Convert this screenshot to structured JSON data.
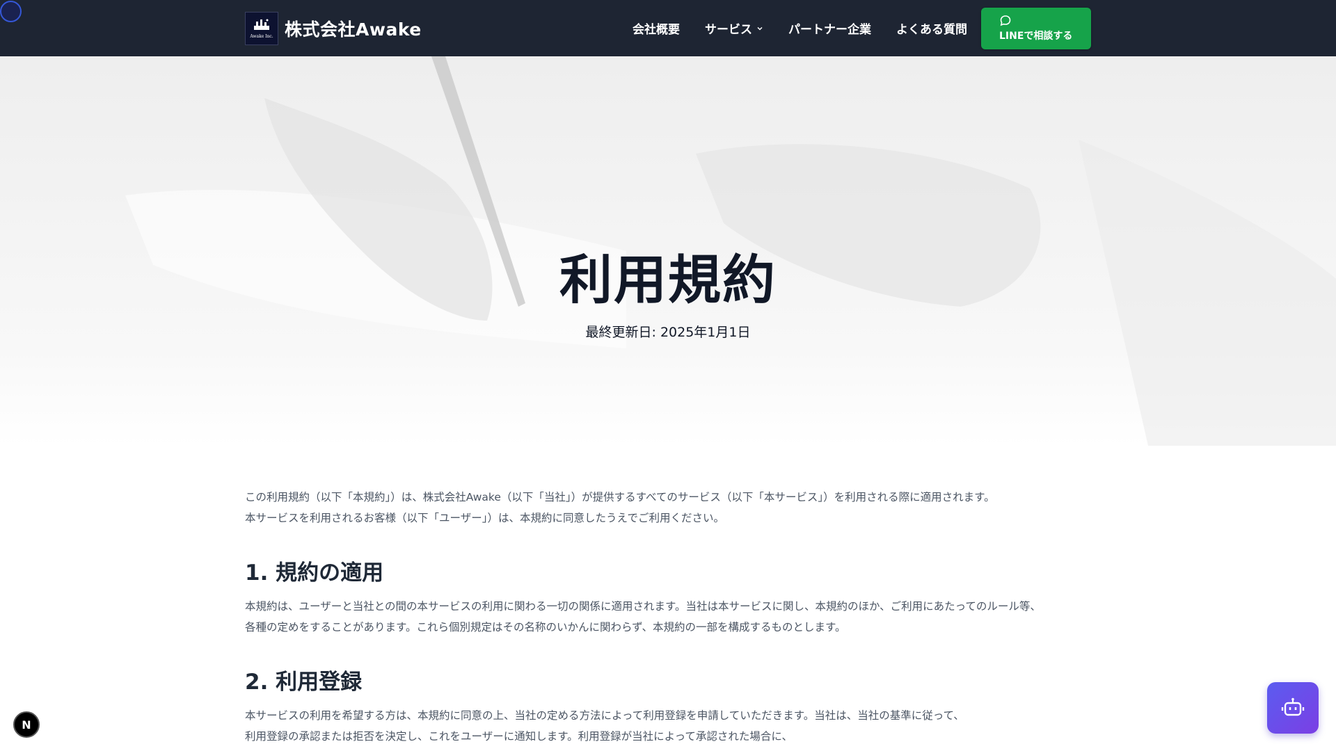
{
  "header": {
    "brand_name": "株式会社Awake",
    "logo_text": "Awake Inc.",
    "nav": [
      {
        "label": "会社概要"
      },
      {
        "label": "サービス"
      },
      {
        "label": "パートナー企業"
      },
      {
        "label": "よくある質問"
      }
    ],
    "line_button_label": "LINEで相談する"
  },
  "hero": {
    "title": "利用規約",
    "updated": "最終更新日: 2025年1月1日"
  },
  "content": {
    "intro": [
      "この利用規約（以下「本規約」）は、株式会社Awake（以下「当社」）が提供するすべてのサービス（以下「本サービス」）を利用される際に適用されます。",
      "本サービスを利用されるお客様（以下「ユーザー」）は、本規約に同意したうえでご利用ください。"
    ],
    "sections": [
      {
        "heading": "1. 規約の適用",
        "lines": [
          "本規約は、ユーザーと当社との間の本サービスの利用に関わる一切の関係に適用されます。当社は本サービスに関し、本規約のほか、ご利用にあたってのルール等、",
          "各種の定めをすることがあります。これら個別規定はその名称のいかんに関わらず、本規約の一部を構成するものとします。"
        ]
      },
      {
        "heading": "2. 利用登録",
        "lines": [
          "本サービスの利用を希望する方は、本規約に同意の上、当社の定める方法によって利用登録を申請していただきます。当社は、当社の基準に従って、",
          "利用登録の承認または拒否を決定し、これをユーザーに通知します。利用登録が当社によって承認された場合に、"
        ]
      }
    ]
  },
  "floating": {
    "n_badge": "N",
    "chat_icon": "robot-icon"
  },
  "colors": {
    "header_bg": "#1e2533",
    "line_green": "#16a34a",
    "chat_gradient_start": "#5b5cf0",
    "chat_gradient_end": "#7b3fe4"
  }
}
